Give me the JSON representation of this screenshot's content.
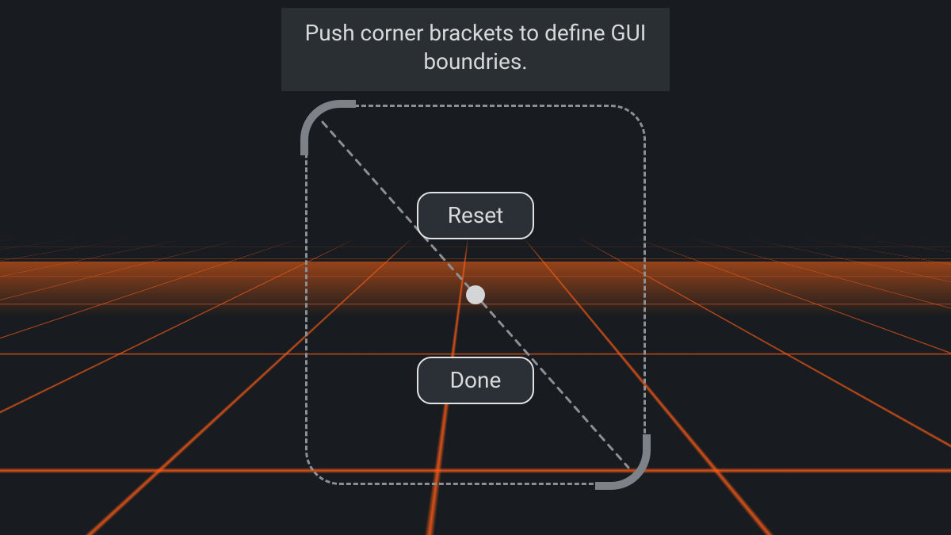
{
  "banner": {
    "text": "Push corner brackets to define GUI boundries."
  },
  "buttons": {
    "reset": "Reset",
    "done": "Done"
  },
  "colors": {
    "accent_grid": "#ff5a14",
    "ui_border": "#e2e3e4",
    "bracket": "#7c8288"
  }
}
